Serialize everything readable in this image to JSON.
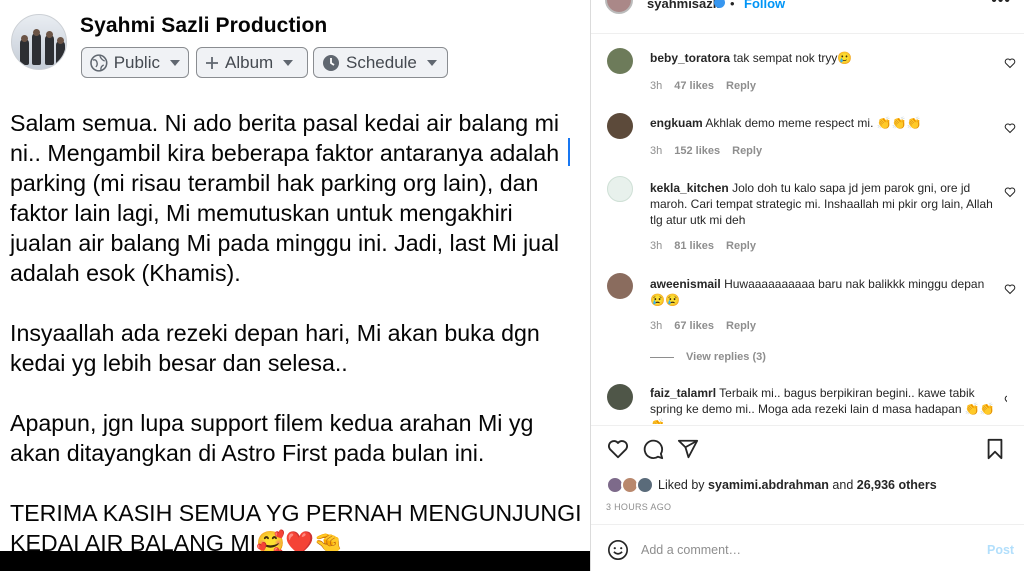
{
  "facebook": {
    "page_name": "Syahmi Sazli Production",
    "buttons": {
      "public": "Public",
      "album": "Album",
      "schedule": "Schedule"
    },
    "post_paragraphs": [
      "Salam semua. Ni ado berita pasal kedai air balang mi\nni.. Mengambil kira beberapa faktor antaranya adalah\nparking (mi risau terambil hak parking org lain), dan\nfaktor lain lagi, Mi memutuskan untuk mengakhiri\njualan air balang Mi pada minggu ini. Jadi, last Mi jual\nadalah esok (Khamis).",
      "Insyaallah ada rezeki depan hari, Mi akan buka dgn\nkedai yg lebih besar dan selesa..",
      "Apapun, jgn lupa support filem kedua arahan Mi yg\nakan ditayangkan di Astro First pada bulan ini.",
      "TERIMA KASIH SEMUA YG PERNAH MENGUNJUNGI\nKEDAI AIR BALANG MI🥰❤️🤏"
    ]
  },
  "instagram": {
    "header": {
      "username": "syahmisazli",
      "separator": "•",
      "follow": "Follow",
      "more": "•••"
    },
    "comments": [
      {
        "username": "beby_toratora",
        "text": "tak sempat nok tryy🥲",
        "time": "3h",
        "likes": "47 likes",
        "reply": "Reply",
        "avatar_color": "#6d7b5a"
      },
      {
        "username": "engkuam",
        "text": "Akhlak demo meme respect mi. 👏👏👏",
        "time": "3h",
        "likes": "152 likes",
        "reply": "Reply",
        "avatar_color": "#5c4a3a"
      },
      {
        "username": "kekla_kitchen",
        "text": "Jolo doh tu kalo sapa jd jem parok gni, ore jd maroh. Cari tempat strategic mi. Inshaallah mi pkir org lain, Allah tlg atur utk mi deh",
        "time": "3h",
        "likes": "81 likes",
        "reply": "Reply",
        "avatar_color": "#e8f1ec"
      },
      {
        "username": "aweenismail",
        "text": "Huwaaaaaaaaaa baru nak balikkk minggu depan 😢😢",
        "time": "3h",
        "likes": "67 likes",
        "reply": "Reply",
        "avatar_color": "#8a6c5e"
      },
      {
        "username": "faiz_talamrl",
        "text": "Terbaik mi.. bagus berpikiran begini.. kawe tabik spring ke demo mi.. Moga ada rezeki lain d masa hadapan 👏👏👏",
        "avatar_color": "#4f5648"
      }
    ],
    "view_replies": "View replies (3)",
    "liked_by": {
      "prefix": "Liked by",
      "user": "syamimi.abdrahman",
      "middle": "and",
      "others": "26,936 others"
    },
    "timestamp": "3 HOURS AGO",
    "add_comment": {
      "placeholder": "Add a comment…",
      "post_label": "Post"
    },
    "colors": {
      "link_blue": "#0095f6",
      "post_disabled": "#b2dffc",
      "muted": "#8e8e8e"
    }
  }
}
